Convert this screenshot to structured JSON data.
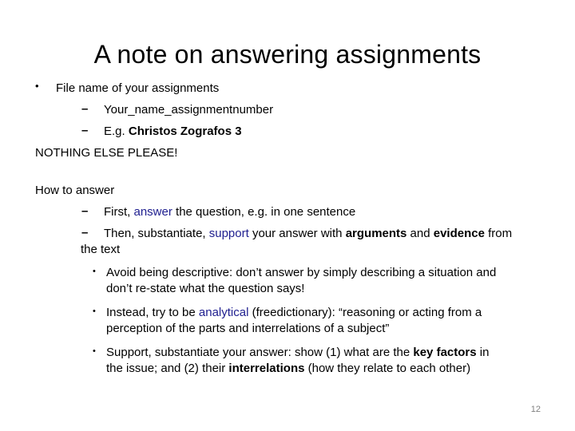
{
  "slide": {
    "title": "A note on answering assignments",
    "page_number": "12",
    "accent_color": "#202090"
  },
  "section1": {
    "bullet": "File name of your assignments",
    "sub_items": [
      {
        "text": "Your_name_assignmentnumber"
      },
      {
        "prefix": "E.g. ",
        "bold": "Christos Zografos 3"
      }
    ],
    "note": "NOTHING ELSE PLEASE!"
  },
  "section2": {
    "heading": "How to answer",
    "items": [
      {
        "p1": "First, ",
        "hl": "answer",
        "p2": " the question, e.g. in one sentence"
      },
      {
        "p1": "Then, substantiate, ",
        "hl": "support",
        "p2": " your answer with ",
        "b1": "arguments",
        "p3": " and ",
        "b2": "evidence",
        "p4": " from",
        "line2": "the text"
      }
    ],
    "sub_bullets": [
      {
        "line1": "Avoid being descriptive: don’t answer by simply describing a situation and",
        "line2": "don’t re-state what the question says!"
      },
      {
        "p1": "Instead, try to be ",
        "hl": "analytical",
        "p2": " (freedictionary): “reasoning or acting from a",
        "line2": "perception of the parts and interrelations of a subject”"
      },
      {
        "p1": "Support, substantiate your answer: show (1) what are the ",
        "b1": "key factors",
        "p2": " in",
        "l2a": "the issue; and (2) their ",
        "b2": "interrelations",
        "l2b": " (how they relate to each other)"
      }
    ]
  }
}
